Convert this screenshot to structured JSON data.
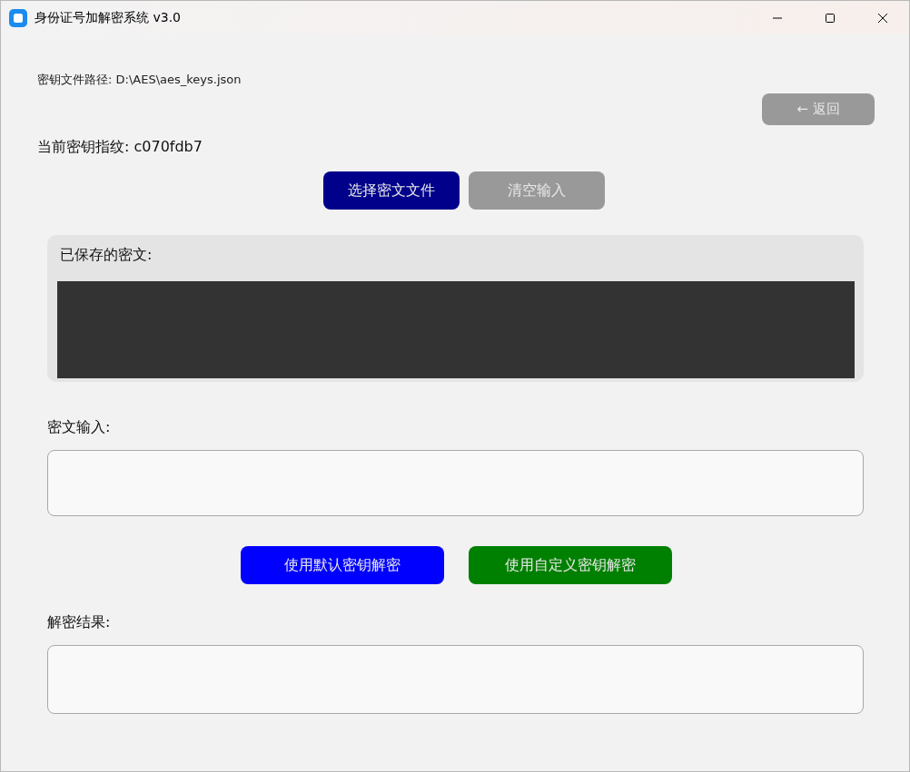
{
  "window": {
    "title": "身份证号加解密系统 v3.0"
  },
  "key_file_path": "密钥文件路径: D:\\AES\\aes_keys.json",
  "back_button": {
    "label": "← 返回",
    "color": "#999999"
  },
  "key_fingerprint": "当前密钥指纹: c070fdb7",
  "file_buttons": [
    {
      "label": "选择密文文件",
      "color": "#00008b"
    },
    {
      "label": "清空输入",
      "color": "#999999"
    }
  ],
  "saved_panel": {
    "title": "已保存的密文:"
  },
  "cipher_input": {
    "label": "密文输入:"
  },
  "decrypt_buttons": [
    {
      "label": "使用默认密钥解密",
      "color": "#0000ff"
    },
    {
      "label": "使用自定义密钥解密",
      "color": "#008000"
    }
  ],
  "result": {
    "label": "解密结果:"
  }
}
